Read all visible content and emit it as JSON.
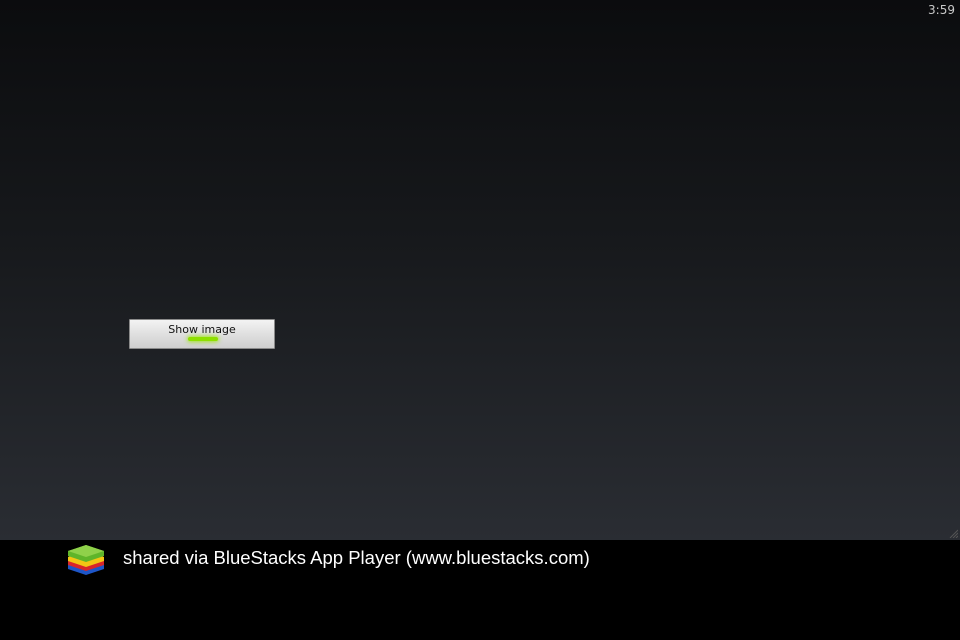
{
  "status_bar": {
    "time": "3:59"
  },
  "app": {
    "button_label": "Show image",
    "indicator_color": "#8ee000"
  },
  "footer": {
    "text": "shared via BlueStacks App Player (www.bluestacks.com)",
    "logo_icon": "bluestacks-logo-icon"
  }
}
